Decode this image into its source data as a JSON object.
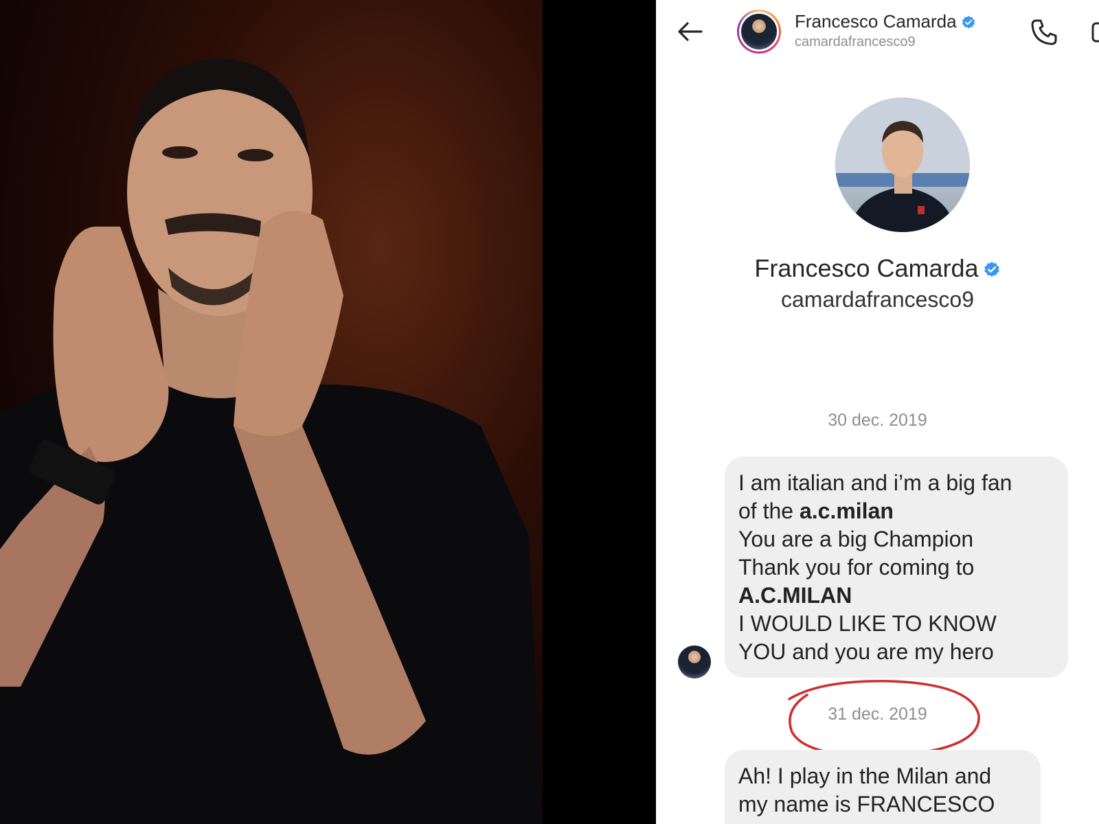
{
  "header": {
    "name": "Francesco Camarda",
    "username": "camardafrancesco9",
    "icons": {
      "back": "back-arrow-icon",
      "call": "phone-icon",
      "verified": "verified-badge-icon"
    }
  },
  "profile": {
    "name": "Francesco Camarda",
    "username": "camardafrancesco9"
  },
  "conversation": {
    "date_1": "30 dec. 2019",
    "message_1": {
      "line_1": "I  am italian and i’m a big fan",
      "line_2_prefix": "of the ",
      "line_2_bold": "a.c.milan",
      "line_3": "You are a big Champion",
      "line_4": "Thank you for coming to",
      "line_5_bold": "A.C.MILAN",
      "line_6": "I WOULD LIKE TO KNOW",
      "line_7": "YOU and you are my hero"
    },
    "date_2": "31 dec. 2019",
    "message_2": {
      "line_1": "Ah! I play in the Milan and",
      "line_2": "my name is FRANCESCO"
    }
  },
  "colors": {
    "verified": "#3897f0",
    "bubble": "#efefef",
    "annotation_circle": "#d42a2a",
    "photo_background": "#2a0d06"
  }
}
